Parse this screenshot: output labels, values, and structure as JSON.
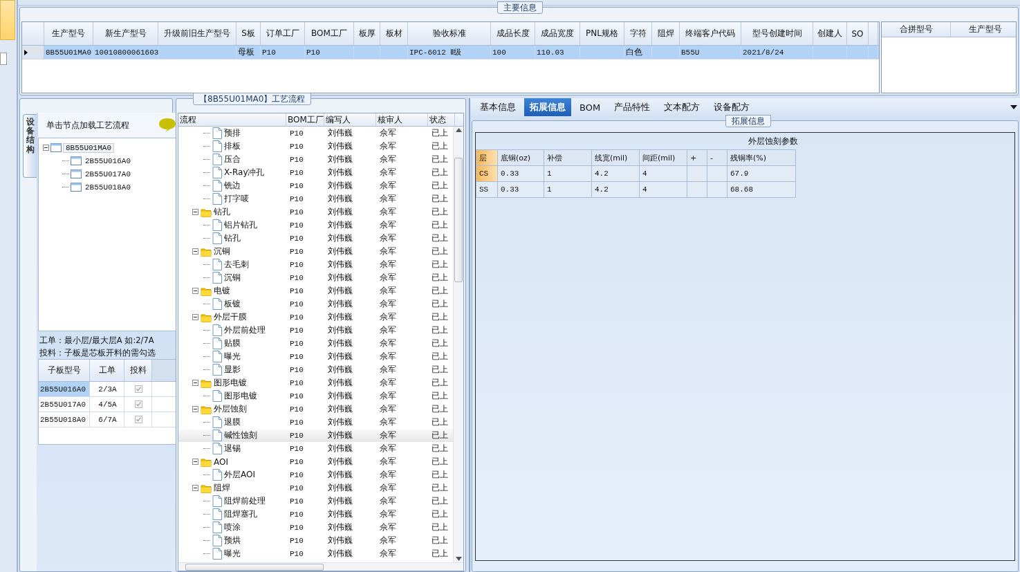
{
  "main_info": {
    "legend": "主要信息",
    "columns": [
      "生产型号",
      "新生产型号",
      "升级前旧生产型号",
      "S板",
      "订单工厂",
      "BOM工厂",
      "板厚",
      "板材",
      "验收标准",
      "成品长度",
      "成品宽度",
      "PNL规格",
      "字符",
      "阻焊",
      "终端客户代码",
      "型号创建时间",
      "创建人",
      "SO"
    ],
    "rows": [
      {
        "selected": true,
        "cells": [
          "8B55U01MA0",
          "10010800061603",
          null,
          "母板",
          "P10",
          "P10",
          null,
          null,
          "IPC-6012 Ⅱ级",
          "100",
          "110.03",
          null,
          "白色",
          null,
          "B55U",
          "2021/8/24",
          null,
          null
        ]
      }
    ],
    "merge_columns": [
      "合拼型号",
      "生产型号"
    ]
  },
  "structure_panel": {
    "side_tab": "设备结构",
    "header": "单击节点加载工艺流程",
    "tree": [
      {
        "label": "8B55U01MA0",
        "expanded": true,
        "selected": true,
        "children": [
          {
            "label": "2B55U016A0",
            "selected": false
          },
          {
            "label": "2B55U017A0",
            "selected": false
          },
          {
            "label": "2B55U018A0",
            "selected": false
          }
        ]
      }
    ],
    "note": [
      "工单：最小层/最大层A 如:2/7A",
      "投料：子板是芯板开料的需勾选"
    ],
    "sub_columns": [
      "子板型号",
      "工单",
      "投料"
    ],
    "sub_rows": [
      {
        "model": "2B55U016A0",
        "work_order": "2/3A",
        "feed": true,
        "selected": true
      },
      {
        "model": "2B55U017A0",
        "work_order": "4/5A",
        "feed": true,
        "selected": false
      },
      {
        "model": "2B55U018A0",
        "work_order": "6/7A",
        "feed": true,
        "selected": false
      }
    ]
  },
  "process_flow": {
    "legend": "【8B55U01MA0】工艺流程",
    "columns": [
      "流程",
      "BOM工厂",
      "编写人",
      "核审人",
      "状态"
    ],
    "tree": [
      {
        "children": [
          {
            "label": "预排",
            "bom": "P10",
            "writer": "刘伟巍",
            "reviewer": "佘军",
            "status": "已上",
            "selected": false
          },
          {
            "label": "排板",
            "bom": "P10",
            "writer": "刘伟巍",
            "reviewer": "佘军",
            "status": "已上",
            "selected": false
          },
          {
            "label": "压合",
            "bom": "P10",
            "writer": "刘伟巍",
            "reviewer": "佘军",
            "status": "已上",
            "selected": false
          },
          {
            "label": "X-Ray冲孔",
            "bom": "P10",
            "writer": "刘伟巍",
            "reviewer": "佘军",
            "status": "已上",
            "selected": false
          },
          {
            "label": "铣边",
            "bom": "P10",
            "writer": "刘伟巍",
            "reviewer": "佘军",
            "status": "已上",
            "selected": false
          },
          {
            "label": "打字唛",
            "bom": "P10",
            "writer": "刘伟巍",
            "reviewer": "佘军",
            "status": "已上",
            "selected": false
          }
        ]
      },
      {
        "label": "钻孔",
        "bom": "P10",
        "writer": "刘伟巍",
        "reviewer": "佘军",
        "status": "已上",
        "selected": false,
        "expanded": true,
        "children": [
          {
            "label": "铝片钻孔",
            "bom": "P10",
            "writer": "刘伟巍",
            "reviewer": "佘军",
            "status": "已上",
            "selected": false
          },
          {
            "label": "钻孔",
            "bom": "P10",
            "writer": "刘伟巍",
            "reviewer": "佘军",
            "status": "已上",
            "selected": false
          }
        ]
      },
      {
        "label": "沉铜",
        "bom": "P10",
        "writer": "刘伟巍",
        "reviewer": "佘军",
        "status": "已上",
        "selected": false,
        "expanded": true,
        "children": [
          {
            "label": "去毛刺",
            "bom": "P10",
            "writer": "刘伟巍",
            "reviewer": "佘军",
            "status": "已上",
            "selected": false
          },
          {
            "label": "沉铜",
            "bom": "P10",
            "writer": "刘伟巍",
            "reviewer": "佘军",
            "status": "已上",
            "selected": false
          }
        ]
      },
      {
        "label": "电镀",
        "bom": "P10",
        "writer": "刘伟巍",
        "reviewer": "佘军",
        "status": "已上",
        "selected": false,
        "expanded": true,
        "children": [
          {
            "label": "板镀",
            "bom": "P10",
            "writer": "刘伟巍",
            "reviewer": "佘军",
            "status": "已上",
            "selected": false
          }
        ]
      },
      {
        "label": "外层干膜",
        "bom": "P10",
        "writer": "刘伟巍",
        "reviewer": "佘军",
        "status": "已上",
        "selected": false,
        "expanded": true,
        "children": [
          {
            "label": "外层前处理",
            "bom": "P10",
            "writer": "刘伟巍",
            "reviewer": "佘军",
            "status": "已上",
            "selected": false
          },
          {
            "label": "贴膜",
            "bom": "P10",
            "writer": "刘伟巍",
            "reviewer": "佘军",
            "status": "已上",
            "selected": false
          },
          {
            "label": "曝光",
            "bom": "P10",
            "writer": "刘伟巍",
            "reviewer": "佘军",
            "status": "已上",
            "selected": false
          },
          {
            "label": "显影",
            "bom": "P10",
            "writer": "刘伟巍",
            "reviewer": "佘军",
            "status": "已上",
            "selected": false
          }
        ]
      },
      {
        "label": "图形电镀",
        "bom": "P10",
        "writer": "刘伟巍",
        "reviewer": "佘军",
        "status": "已上",
        "selected": false,
        "expanded": true,
        "children": [
          {
            "label": "图形电镀",
            "bom": "P10",
            "writer": "刘伟巍",
            "reviewer": "佘军",
            "status": "已上",
            "selected": false
          }
        ]
      },
      {
        "label": "外层蚀刻",
        "bom": "P10",
        "writer": "刘伟巍",
        "reviewer": "佘军",
        "status": "已上",
        "selected": false,
        "expanded": true,
        "children": [
          {
            "label": "退膜",
            "bom": "P10",
            "writer": "刘伟巍",
            "reviewer": "佘军",
            "status": "已上",
            "selected": false
          },
          {
            "label": "碱性蚀刻",
            "bom": "P10",
            "writer": "刘伟巍",
            "reviewer": "佘军",
            "status": "已上",
            "selected": true
          },
          {
            "label": "退锡",
            "bom": "P10",
            "writer": "刘伟巍",
            "reviewer": "佘军",
            "status": "已上",
            "selected": false
          }
        ]
      },
      {
        "label": "AOI",
        "bom": "P10",
        "writer": "刘伟巍",
        "reviewer": "佘军",
        "status": "已上",
        "selected": false,
        "expanded": true,
        "children": [
          {
            "label": "外层AOI",
            "bom": "P10",
            "writer": "刘伟巍",
            "reviewer": "佘军",
            "status": "已上",
            "selected": false
          }
        ]
      },
      {
        "label": "阻焊",
        "bom": "P10",
        "writer": "刘伟巍",
        "reviewer": "佘军",
        "status": "已上",
        "selected": false,
        "expanded": true,
        "children": [
          {
            "label": "阻焊前处理",
            "bom": "P10",
            "writer": "刘伟巍",
            "reviewer": "佘军",
            "status": "已上",
            "selected": false
          },
          {
            "label": "阻焊塞孔",
            "bom": "P10",
            "writer": "刘伟巍",
            "reviewer": "佘军",
            "status": "已上",
            "selected": false
          },
          {
            "label": "喷涂",
            "bom": "P10",
            "writer": "刘伟巍",
            "reviewer": "佘军",
            "status": "已上",
            "selected": false
          },
          {
            "label": "预烘",
            "bom": "P10",
            "writer": "刘伟巍",
            "reviewer": "佘军",
            "status": "已上",
            "selected": false
          },
          {
            "label": "曝光",
            "bom": "P10",
            "writer": "刘伟巍",
            "reviewer": "佘军",
            "status": "已上",
            "selected": false
          }
        ]
      }
    ]
  },
  "detail": {
    "tabs": [
      {
        "label": "基本信息",
        "selected": false
      },
      {
        "label": "拓展信息",
        "selected": true
      },
      {
        "label": "BOM",
        "selected": false
      },
      {
        "label": "产品特性",
        "selected": false
      },
      {
        "label": "文本配方",
        "selected": false
      },
      {
        "label": "设备配方",
        "selected": false
      }
    ],
    "group_legend": "拓展信息",
    "grid": {
      "title": "外层蚀刻参数",
      "columns": [
        "层",
        "底铜(oz)",
        "补偿",
        "线宽(mil)",
        "间距(mil)",
        "+",
        "-",
        "残铜率(%)"
      ],
      "rows": [
        {
          "selected": true,
          "cells": [
            "CS",
            "0.33",
            "1",
            "4.2",
            "4",
            null,
            null,
            "67.9"
          ]
        },
        {
          "selected": false,
          "cells": [
            "SS",
            "0.33",
            "1",
            "4.2",
            "4",
            null,
            null,
            "68.68"
          ]
        }
      ]
    }
  }
}
